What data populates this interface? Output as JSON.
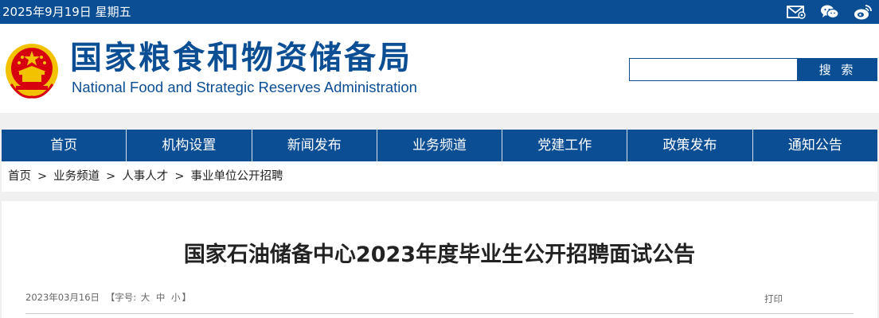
{
  "topbar": {
    "date": "2025年9月19日 星期五",
    "icons": [
      "mail-icon",
      "wechat-icon",
      "weibo-icon"
    ]
  },
  "header": {
    "title_cn": "国家粮食和物资储备局",
    "title_en": "National Food and Strategic Reserves Administration",
    "search": {
      "value": "",
      "button_label": "搜 索"
    }
  },
  "nav": {
    "items": [
      "首页",
      "机构设置",
      "新闻发布",
      "业务频道",
      "党建工作",
      "政策发布",
      "通知公告"
    ]
  },
  "breadcrumb": {
    "items": [
      "首页",
      "业务频道",
      "人事人才",
      "事业单位公开招聘"
    ],
    "separator": ">"
  },
  "article": {
    "title": "国家石油储备中心2023年度毕业生公开招聘面试公告",
    "date": "2023年03月16日",
    "font_size_open": "【字号:",
    "font_sizes": [
      "大",
      "中",
      "小"
    ],
    "font_size_close": "】",
    "print_label": "打印"
  },
  "colors": {
    "brand": "#0b4e94",
    "emblem_red": "#d7000f",
    "emblem_gold": "#f2c200"
  }
}
